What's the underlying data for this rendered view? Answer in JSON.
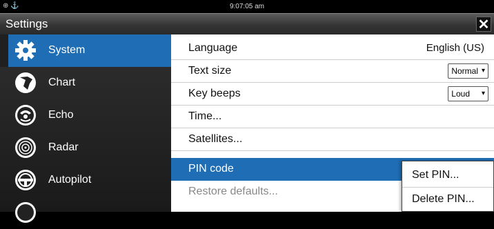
{
  "status": {
    "time": "9:07:05 am"
  },
  "header": {
    "title": "Settings",
    "close_label": "✕"
  },
  "sidebar": {
    "items": [
      {
        "label": "System",
        "icon": "gear-icon"
      },
      {
        "label": "Chart",
        "icon": "chart-icon"
      },
      {
        "label": "Echo",
        "icon": "echo-icon"
      },
      {
        "label": "Radar",
        "icon": "radar-icon"
      },
      {
        "label": "Autopilot",
        "icon": "autopilot-icon"
      }
    ]
  },
  "settings": {
    "language": {
      "label": "Language",
      "value": "English (US)"
    },
    "text_size": {
      "label": "Text size",
      "value": "Normal"
    },
    "key_beeps": {
      "label": "Key beeps",
      "value": "Loud"
    },
    "time": {
      "label": "Time..."
    },
    "satellites": {
      "label": "Satellites..."
    },
    "pin_code": {
      "label": "PIN code"
    },
    "restore": {
      "label": "Restore defaults..."
    }
  },
  "popup": {
    "items": [
      "Set PIN...",
      "Delete PIN..."
    ]
  },
  "colors": {
    "accent": "#1e6db5",
    "sidebar": "#2a2a2a",
    "content": "#ffffff"
  }
}
